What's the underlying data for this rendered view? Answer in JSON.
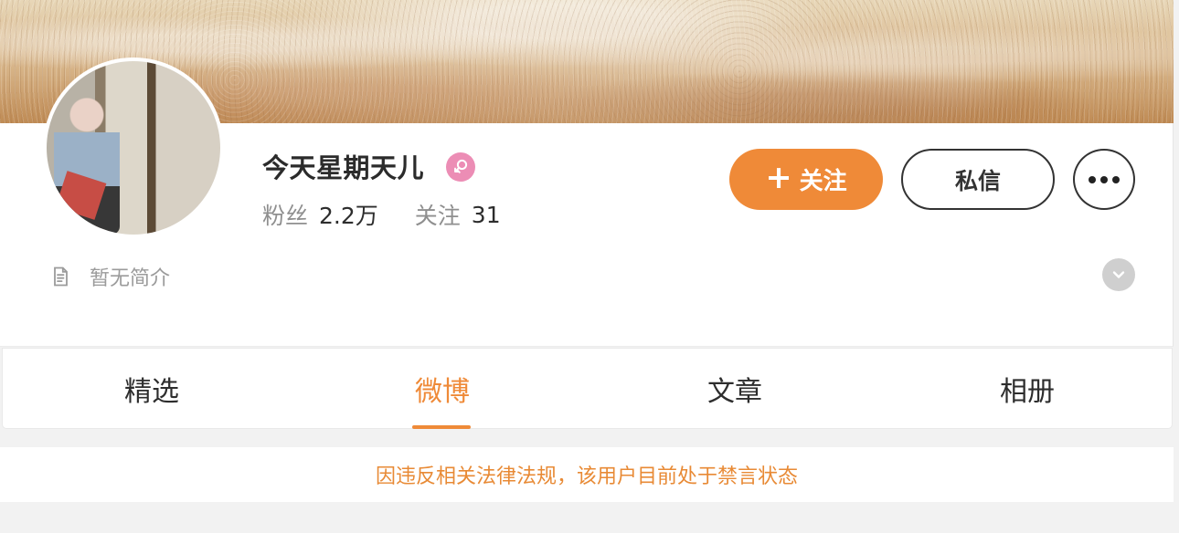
{
  "profile": {
    "nickname": "今天星期天儿",
    "stats": [
      {
        "label": "粉丝",
        "value": "2.2万"
      },
      {
        "label": "关注",
        "value": "31"
      }
    ],
    "bio": "暂无简介",
    "gender": "female",
    "icons": {
      "gender": "female-gender-icon",
      "bio": "document-icon",
      "expand": "chevron-down-icon",
      "more": "more-dots-icon"
    }
  },
  "actions": {
    "follow_label": "关注",
    "message_label": "私信"
  },
  "tabs": [
    {
      "label": "精选",
      "active": false
    },
    {
      "label": "微博",
      "active": true
    },
    {
      "label": "文章",
      "active": false
    },
    {
      "label": "相册",
      "active": false
    }
  ],
  "notice": {
    "text": "因违反相关法律法规，该用户目前处于禁言状态"
  },
  "colors": {
    "accent": "#ef8a38",
    "gender_badge": "#ec8db5",
    "text": "#2d2d2d",
    "muted": "#8f8f8f",
    "background": "#f2f2f2"
  }
}
